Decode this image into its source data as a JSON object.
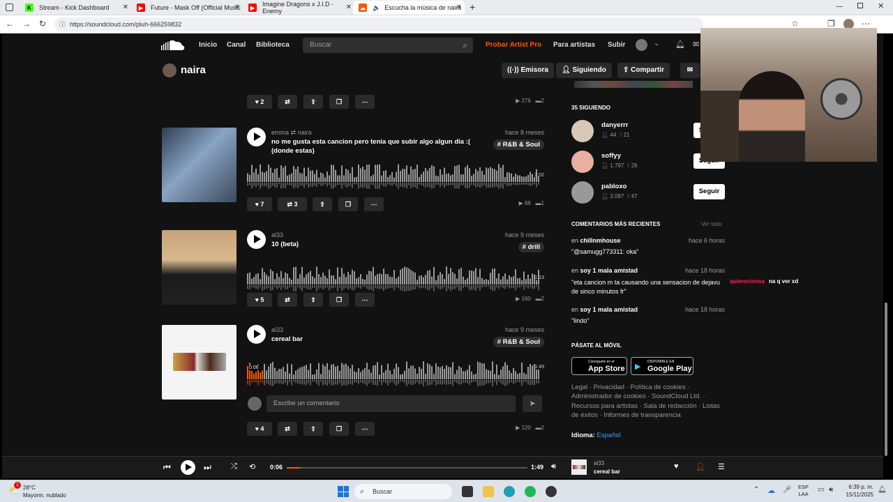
{
  "browser": {
    "tabs": [
      {
        "label": "Stream - Kick Dashboard",
        "favicon": "kick-icon",
        "color": "#53fc18"
      },
      {
        "label": "Future - Mask Off (Official Music",
        "favicon": "youtube-icon",
        "color": "#ff0000"
      },
      {
        "label": "Imagine Dragons x J.I.D - Enemy",
        "favicon": "youtube-icon",
        "color": "#ff0000"
      },
      {
        "label": "Escucha la música de naira",
        "favicon": "soundcloud-icon",
        "color": "#ff5500",
        "active": true
      }
    ],
    "url": "https://soundcloud.com/pluh-666259832"
  },
  "sc": {
    "nav": {
      "home": "Inicio",
      "feed": "Canal",
      "library": "Biblioteca",
      "search_placeholder": "Buscar",
      "artist_pro": "Probar Artist Pro",
      "for_artists": "Para artistas",
      "upload": "Subir"
    },
    "profile": {
      "name": "naira",
      "station": "Emisora",
      "following": "Siguiendo",
      "share": "Compartir"
    },
    "prev_track": {
      "likes": "2",
      "plays": "276",
      "comments": "2"
    },
    "tracks": [
      {
        "artist": "emma",
        "reposter": "naira",
        "title": "no me gusta esta cancion pero tenia que subir algo algun dia :( (donde estas)",
        "date": "hace 8 meses",
        "tag": "# R&B & Soul",
        "duration": "2:02",
        "likes": "7",
        "reposts": "3",
        "plays": "66",
        "comments": "1",
        "art_color": "#4b6a8a"
      },
      {
        "artist": "al33",
        "reposter": "",
        "title": "10 (beta)",
        "date": "hace 9 meses",
        "tag": "# drill",
        "duration": "1:13",
        "likes": "5",
        "reposts": "",
        "plays": "160",
        "comments": "2",
        "art_color": "#b08a62"
      },
      {
        "artist": "al33",
        "reposter": "",
        "title": "cereal bar",
        "date": "hace 9 meses",
        "tag": "# R&B & Soul",
        "duration": "1:49",
        "elapsed": "0:06",
        "likes": "4",
        "reposts": "",
        "plays": "120",
        "comments": "2",
        "art_color": "#f4f4f4"
      }
    ],
    "comment_placeholder": "Escribe un comentario",
    "sidebar": {
      "following_header": "35 SIGUIENDO",
      "users": [
        {
          "name": "danyerrr",
          "followers": "44",
          "tracks": "21",
          "follow": "Seguir"
        },
        {
          "name": "soffyy",
          "followers": "1.797",
          "tracks": "26",
          "follow": "Seguir"
        },
        {
          "name": "pabloxo",
          "followers": "3.087",
          "tracks": "47",
          "follow": "Seguir"
        }
      ],
      "comments_header": "COMENTARIOS MÁS RECIENTES",
      "view_all": "Ver todo",
      "comments": [
        {
          "prefix": "en",
          "track": "chillnmhouse",
          "time": "hace 6 horas",
          "text": "\"@samugg773311: oka\""
        },
        {
          "prefix": "en",
          "track": "soy 1 mala amistad",
          "time": "hace 18 horas",
          "text": "\"eta cancion m ta causando una sensacion de dejavu de sinco minutos fr\""
        },
        {
          "prefix": "en",
          "track": "soy 1 mala amistad",
          "time": "hace 18 horas",
          "text": "\"lindo\""
        }
      ],
      "mobile_header": "PÁSATE AL MÓVIL",
      "app_store": {
        "small": "Consíguelo en el",
        "big": "App Store"
      },
      "google_play": {
        "small": "DISPONIBLE EN",
        "big": "Google Play"
      },
      "footer": "Legal · Privacidad · Política de cookies · Administrador de cookies · SoundCloud Ltd. · Recursos para artistas · Sala de redacción · Listas de éxitos · Informes de transparencia",
      "language_label": "Idioma:",
      "language": "Español"
    },
    "player": {
      "elapsed": "0:06",
      "total": "1:49",
      "progress": 0.055,
      "artist": "al33",
      "title": "cereal bar"
    }
  },
  "overlay": {
    "user": "quierocionsa",
    "text": "na q ver xd"
  },
  "taskbar": {
    "weather_temp": "28°C",
    "weather_desc": "Mayorm. nublado",
    "search": "Buscar",
    "lang": "ESP",
    "lang2": "LAA",
    "time": "6:39 p. m.",
    "date": "15/11/2025",
    "notif_count": "1"
  }
}
